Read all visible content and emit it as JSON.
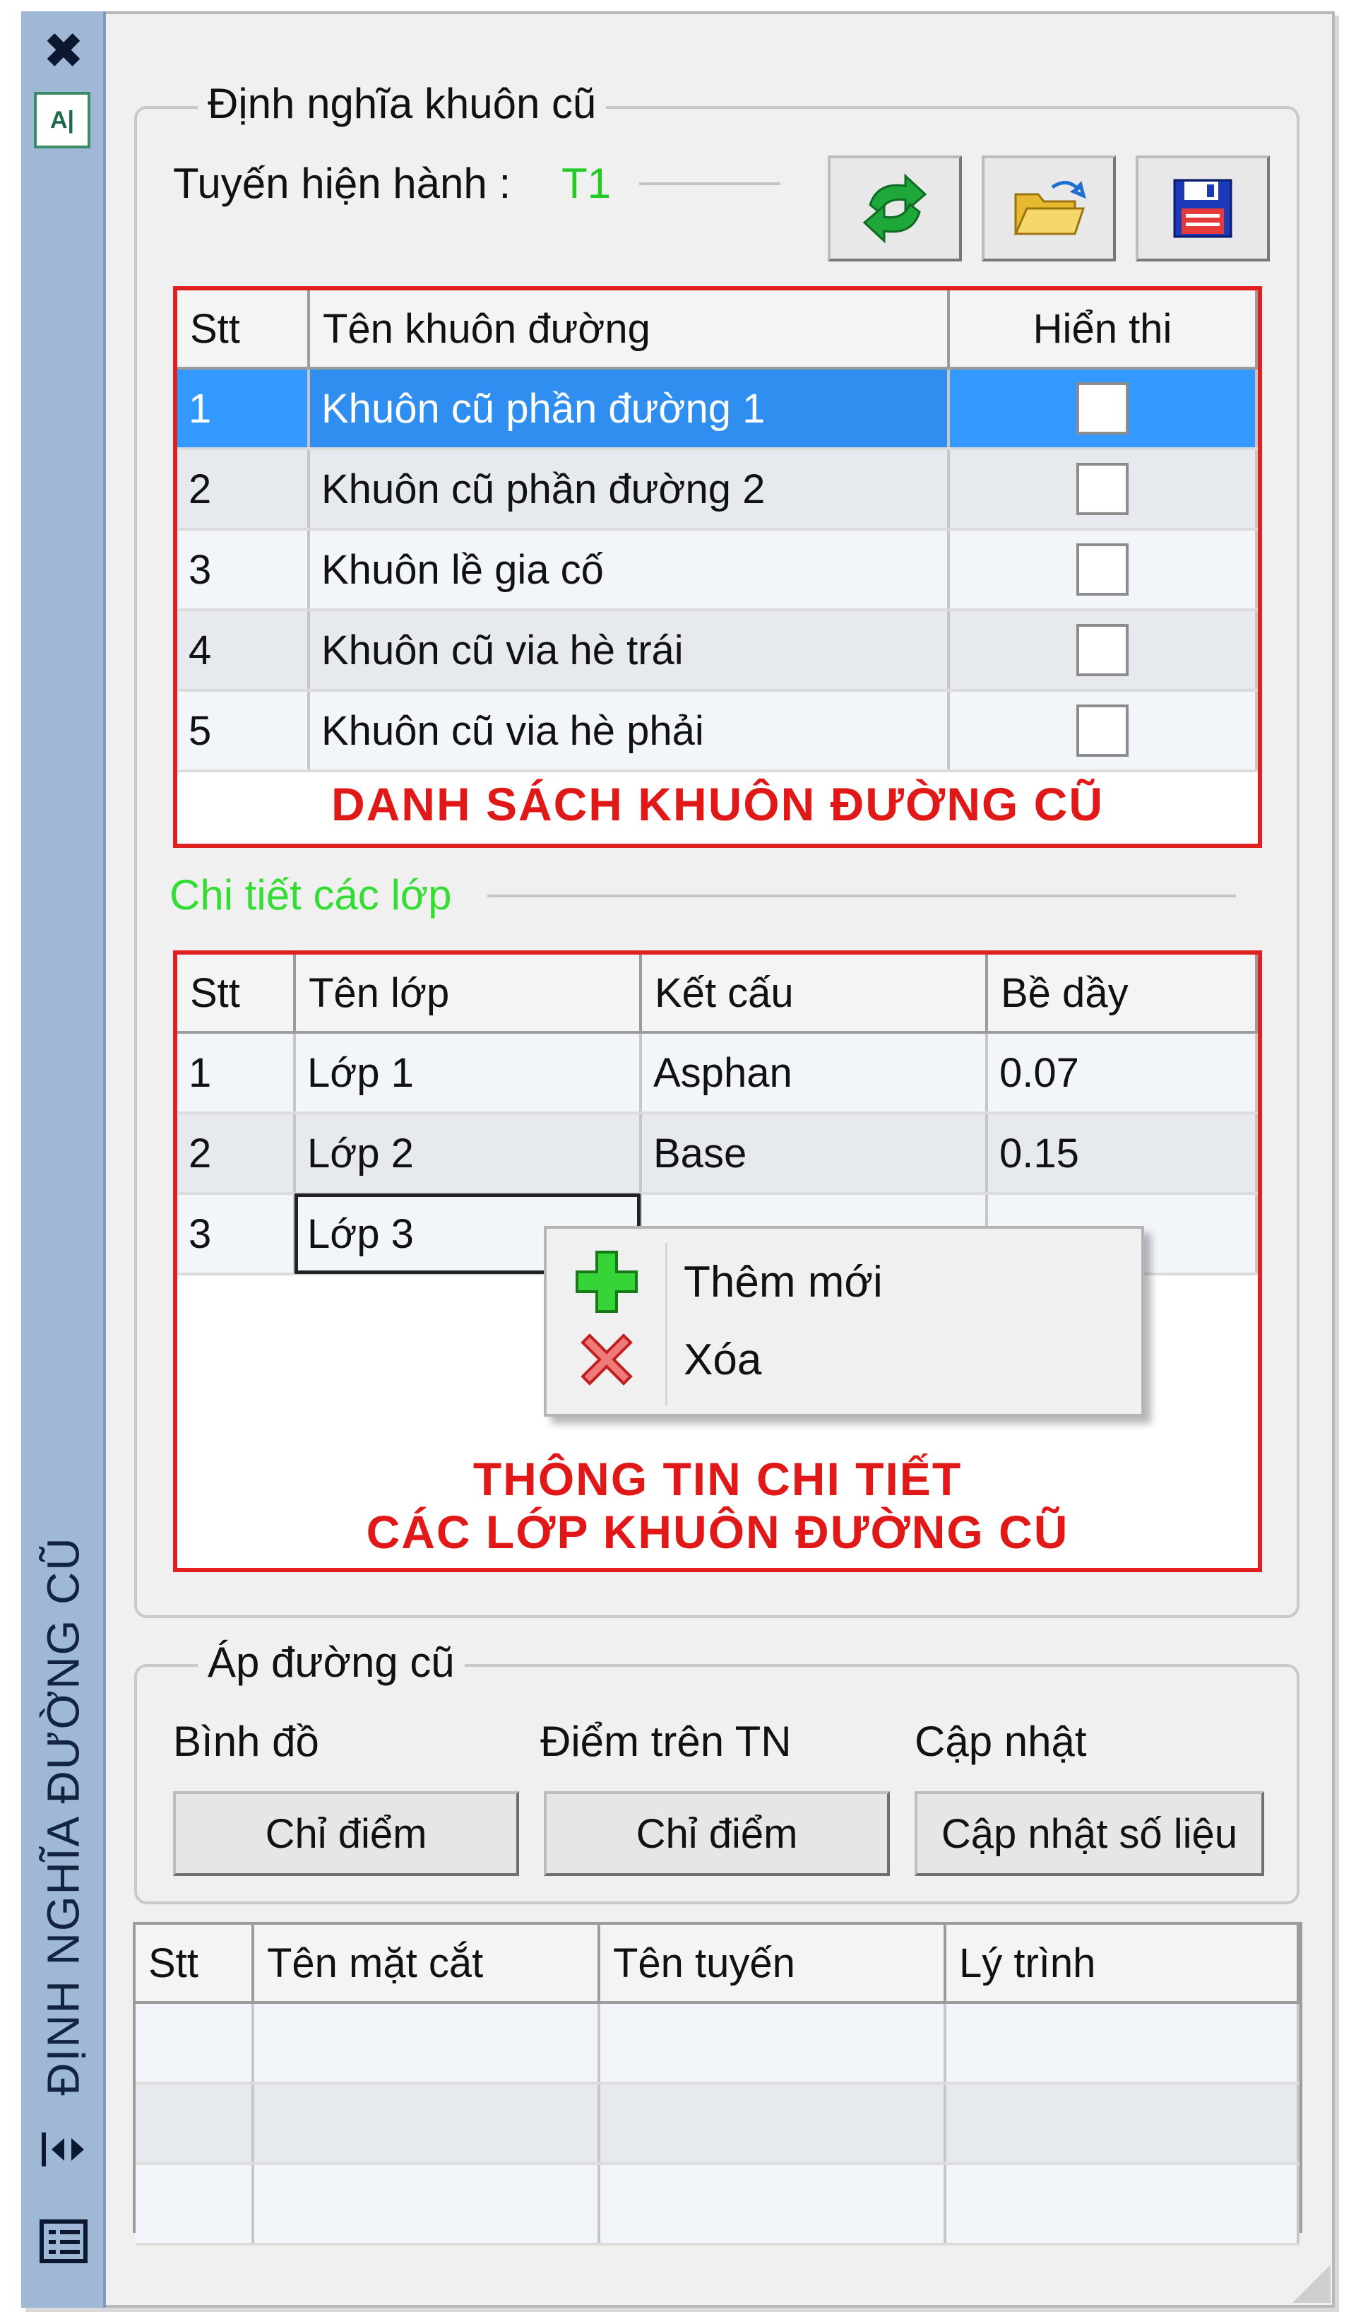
{
  "sidebar": {
    "title": "ĐỊNH NGHĨA ĐƯỜNG CŨ",
    "close_icon": "✖",
    "top_icon": "A|"
  },
  "define_group": {
    "legend": "Định nghĩa khuôn cũ",
    "current_route_label": "Tuyến hiện hành :",
    "current_route_value": "T1",
    "current_route_color": "#22cc22",
    "toolbar": {
      "refresh_icon": "refresh-arrows-icon",
      "open_icon": "open-folder-icon",
      "save_icon": "save-disk-icon"
    }
  },
  "template_table": {
    "columns": [
      "Stt",
      "Tên khuôn đường",
      "Hiển thi"
    ],
    "rows": [
      {
        "stt": "1",
        "name": "Khuôn cũ phần đường 1",
        "checked": false,
        "selected": true
      },
      {
        "stt": "2",
        "name": "Khuôn cũ phần đường 2",
        "checked": false,
        "selected": false
      },
      {
        "stt": "3",
        "name": "Khuôn lề gia cố",
        "checked": false,
        "selected": false
      },
      {
        "stt": "4",
        "name": "Khuôn cũ via hè trái",
        "checked": false,
        "selected": false
      },
      {
        "stt": "5",
        "name": "Khuôn cũ via hè phải",
        "checked": false,
        "selected": false
      }
    ],
    "caption": "DANH SÁCH KHUÔN ĐƯỜNG CŨ",
    "caption_color": "#e01818"
  },
  "layer_section": {
    "title": "Chi tiết các lớp",
    "title_color": "#33dd33"
  },
  "layer_table": {
    "columns": [
      "Stt",
      "Tên lớp",
      "Kết cấu",
      "Bề dầy"
    ],
    "rows": [
      {
        "stt": "1",
        "name": "Lớp 1",
        "structure": "Asphan",
        "thickness": "0.07"
      },
      {
        "stt": "2",
        "name": "Lớp 2",
        "structure": "Base",
        "thickness": "0.15"
      },
      {
        "stt": "3",
        "name": "Lớp 3",
        "structure": "",
        "thickness": ""
      }
    ],
    "caption_line1": "THÔNG TIN CHI TIẾT",
    "caption_line2": "CÁC LỚP KHUÔN ĐƯỜNG CŨ"
  },
  "context_menu": {
    "items": [
      {
        "label": "Thêm mới",
        "icon": "plus-icon"
      },
      {
        "label": "Xóa",
        "icon": "delete-x-icon"
      }
    ]
  },
  "apply_group": {
    "legend": "Áp đường cũ",
    "col1_label": "Bình đồ",
    "col2_label": "Điểm trên TN",
    "col3_label": "Cập nhật",
    "btn1": "Chỉ điểm",
    "btn2": "Chỉ điểm",
    "btn3": "Cập nhật số liệu"
  },
  "section_table": {
    "columns": [
      "Stt",
      "Tên mặt cắt",
      "Tên tuyến",
      "Lý trình"
    ],
    "empty_rows": 3
  },
  "colors": {
    "selection": "#3399ff",
    "highlight_border": "#e02020",
    "titlebar": "#9fb8d6"
  }
}
